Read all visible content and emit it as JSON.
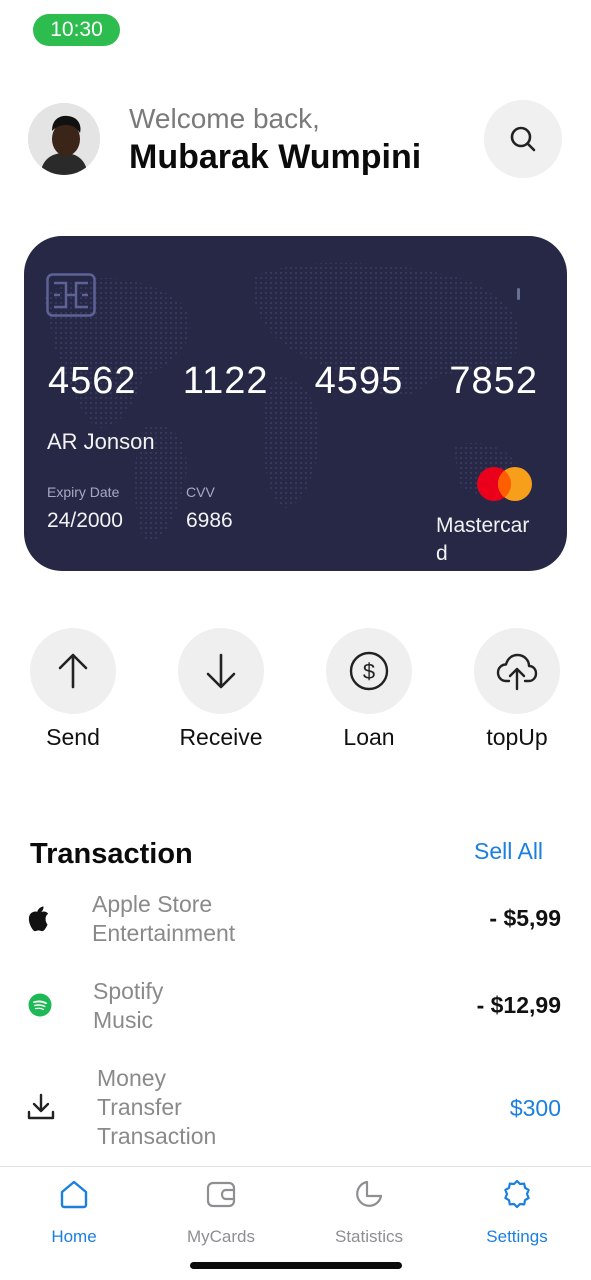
{
  "status_bar": {
    "time": "10:30"
  },
  "header": {
    "greeting": "Welcome back,",
    "user_name": "Mubarak Wumpini",
    "avatar_icon": "user-avatar",
    "search_icon": "search-icon"
  },
  "card": {
    "number_groups": [
      "4562",
      "1122",
      "4595",
      "7852"
    ],
    "holder": "AR Jonson",
    "expiry_label": "Expiry Date",
    "expiry_value": "24/2000",
    "cvv_label": "CVV",
    "cvv_value": "6986",
    "brand": "Mastercard",
    "colors": {
      "background": "#262845",
      "mc_red": "#eb001b",
      "mc_orange": "#f79e1b"
    }
  },
  "actions": [
    {
      "label": "Send",
      "icon": "arrow-up-icon"
    },
    {
      "label": "Receive",
      "icon": "arrow-down-icon"
    },
    {
      "label": "Loan",
      "icon": "dollar-circle-icon"
    },
    {
      "label": "topUp",
      "icon": "cloud-upload-icon"
    }
  ],
  "transactions": {
    "title": "Transaction",
    "see_all": "Sell All",
    "items": [
      {
        "name": "Apple Store Entertainment",
        "line1": "Apple Store",
        "line2": "Entertainment",
        "amount": "- $5,99",
        "icon": "apple-icon"
      },
      {
        "name": "Spotify Music",
        "line1": "Spotify",
        "line2": "Music",
        "amount": "- $12,99",
        "icon": "spotify-icon"
      },
      {
        "name": "Money Transfer Transaction",
        "line1": "Money",
        "line2": "Transfer",
        "line3": "Transaction",
        "amount": "$300",
        "icon": "download-icon"
      }
    ]
  },
  "bottom_nav": {
    "items": [
      {
        "label": "Home",
        "icon": "home-icon",
        "active": true
      },
      {
        "label": "MyCards",
        "icon": "wallet-icon",
        "active": false
      },
      {
        "label": "Statistics",
        "icon": "pie-chart-icon",
        "active": false
      },
      {
        "label": "Settings",
        "icon": "gear-icon",
        "active": true
      }
    ]
  },
  "colors": {
    "accent": "#1a7fe0",
    "status_green": "#2dbd4e",
    "spotify_green": "#1db954"
  }
}
